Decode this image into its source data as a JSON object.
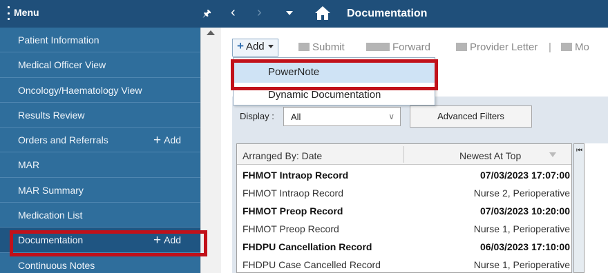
{
  "menu": {
    "title": "Menu",
    "items": [
      {
        "label": "Patient Information",
        "add": ""
      },
      {
        "label": "Medical Officer View",
        "add": ""
      },
      {
        "label": "Oncology/Haematology View",
        "add": ""
      },
      {
        "label": "Results Review",
        "add": ""
      },
      {
        "label": "Orders and Referrals",
        "add": "Add"
      },
      {
        "label": "MAR",
        "add": ""
      },
      {
        "label": "MAR Summary",
        "add": ""
      },
      {
        "label": "Medication List",
        "add": ""
      },
      {
        "label": "Documentation",
        "add": "Add"
      },
      {
        "label": "Continuous Notes",
        "add": ""
      }
    ]
  },
  "nav": {
    "title": "Documentation"
  },
  "toolbar": {
    "add_label": "Add",
    "submit_label": "Submit",
    "forward_label": "Forward",
    "provider_letter_label": "Provider Letter",
    "mod_label": "Mo"
  },
  "dropdown": {
    "items": [
      "PowerNote",
      "Dynamic Documentation"
    ]
  },
  "filters": {
    "display_label": "Display :",
    "display_value": "All",
    "advanced_filters": "Advanced Filters"
  },
  "grid": {
    "col_left": "Arranged By: Date",
    "col_right": "Newest At Top",
    "rows": [
      {
        "left": "FHMOT Intraop Record",
        "right": "07/03/2023 17:07:00",
        "style": "bold"
      },
      {
        "left": "FHMOT Intraop Record",
        "right": "Nurse 2, Perioperative",
        "style": "sub"
      },
      {
        "left": "FHMOT Preop Record",
        "right": "07/03/2023 10:20:00",
        "style": "bold"
      },
      {
        "left": "FHMOT Preop Record",
        "right": "Nurse 1, Perioperative",
        "style": "sub"
      },
      {
        "left": "FHDPU Cancellation Record",
        "right": "06/03/2023 17:10:00",
        "style": "bold"
      },
      {
        "left": "FHDPU Case Cancelled Record",
        "right": "Nurse 1, Perioperative",
        "style": "sub"
      }
    ]
  },
  "colors": {
    "menu_bg": "#2f6e9c",
    "header_bg": "#1f4f7a",
    "highlight": "#c1111a",
    "selection": "#cfe3f5"
  },
  "icons": {
    "menu": "dots-icon",
    "pin": "pin-icon",
    "home": "home-icon",
    "add": "plus-icon"
  }
}
